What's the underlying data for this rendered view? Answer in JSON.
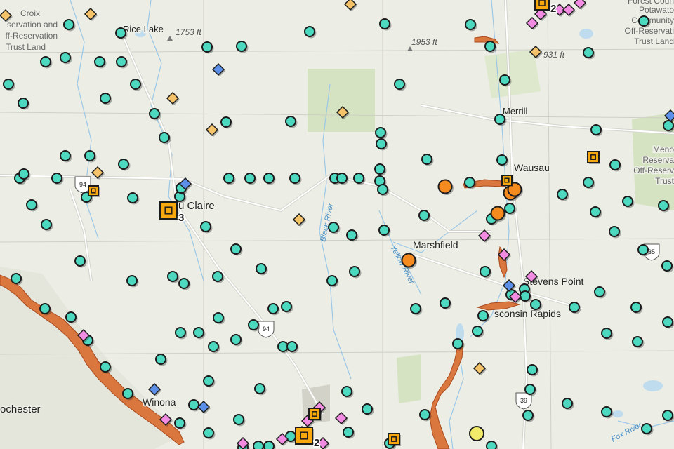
{
  "colors": {
    "land": "#eceee6",
    "forest": "#d5e3c2",
    "water": "#bfdcef",
    "river": "#9cc7e6",
    "road": "#ffffff",
    "road_casing": "#d4d4cc",
    "county_line": "#cfcfc6",
    "flood_fill": "#d9773e",
    "flood_edge": "#a94a1d",
    "station": "#4dd8c0",
    "station_orange": "#f58b1e",
    "station_yellow": "#f2ea6a",
    "marker_outline": "#1c1c1c",
    "diamond_orange": "#f5c46a",
    "diamond_pink": "#f28ce3",
    "diamond_blue": "#5b8fe8",
    "cluster_fill": "#f7a80f"
  },
  "places": [
    {
      "id": "rice-lake",
      "name": "Rice Lake"
    },
    {
      "id": "eau-claire",
      "name": "u Claire"
    },
    {
      "id": "merrill",
      "name": "Merrill"
    },
    {
      "id": "wausau",
      "name": "Wausau"
    },
    {
      "id": "marshfield",
      "name": "Marshfield"
    },
    {
      "id": "stevens-point",
      "name": "Stevens Point"
    },
    {
      "id": "wisconsin-rapids",
      "name": "sconsin Rapids"
    },
    {
      "id": "winona",
      "name": "Winona"
    },
    {
      "id": "rochester",
      "name": "ochester"
    }
  ],
  "reservations": {
    "croix": [
      "Croix",
      "servation and",
      "ff-Reservation",
      "Trust Land"
    ],
    "forest_county_potawatomi": [
      "Forest Coun",
      "Potawato",
      "Community",
      "Off-Reservati",
      "Trust Land"
    ],
    "menominee": [
      "Meno",
      "Reserva",
      "Off-Reserv",
      "Trust"
    ]
  },
  "elevations": [
    "1753 ft",
    "1953 ft",
    "931 ft"
  ],
  "rivers": [
    "Black River",
    "Yellow River",
    "Fox River"
  ],
  "highways": [
    "94",
    "94",
    "39",
    "35"
  ],
  "cluster_counts": [
    "2",
    "3",
    "2"
  ]
}
